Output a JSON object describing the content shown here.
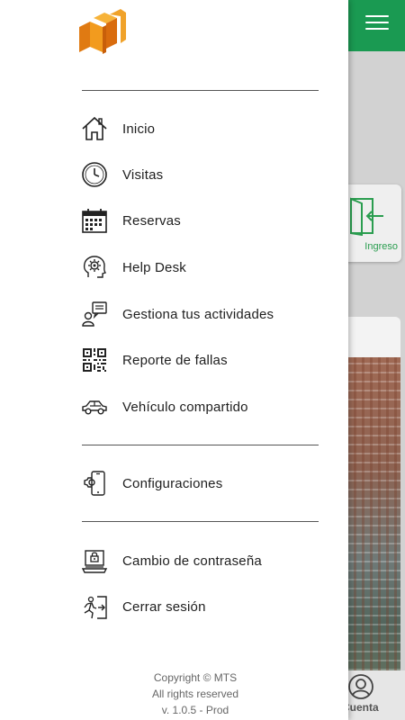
{
  "app": {
    "menu_icon": "hamburger-menu-icon",
    "ingreso_label": "Ingreso",
    "cuenta_label": "Cuenta",
    "brand_green": "#1a9a52"
  },
  "drawer": {
    "logo": "company-logo",
    "menu_items": [
      {
        "label": "Inicio",
        "icon": "home-icon"
      },
      {
        "label": "Visitas",
        "icon": "clock-icon"
      },
      {
        "label": "Reservas",
        "icon": "calendar-icon"
      },
      {
        "label": "Help Desk",
        "icon": "brain-gear-icon"
      },
      {
        "label": "Gestiona tus actividades",
        "icon": "person-chat-icon"
      },
      {
        "label": "Reporte de fallas",
        "icon": "qr-code-icon"
      },
      {
        "label": "Vehículo compartido",
        "icon": "car-icon"
      }
    ],
    "settings": {
      "label": "Configuraciones",
      "icon": "phone-settings-icon"
    },
    "account_items": [
      {
        "label": "Cambio de contraseña",
        "icon": "laptop-lock-icon"
      },
      {
        "label": "Cerrar sesión",
        "icon": "exit-door-icon"
      }
    ],
    "footer": {
      "copyright": "Copyright © MTS",
      "rights": "All rights reserved",
      "version": "v. 1.0.5 - Prod"
    }
  }
}
